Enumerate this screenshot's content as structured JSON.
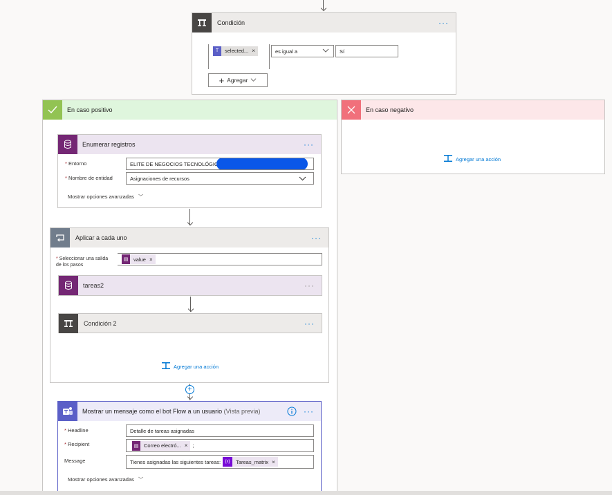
{
  "condition": {
    "title": "Condición",
    "token_label": "selected...",
    "operator": "es igual a",
    "value": "Sí",
    "add_label": "Agregar",
    "menu": "···"
  },
  "yes_branch": {
    "title": "En caso positivo"
  },
  "no_branch": {
    "title": "En caso negativo",
    "add_action": "Agregar una acción"
  },
  "list_records": {
    "title": "Enumerar registros",
    "menu": "···",
    "env_label": "Entorno",
    "env_value": "ELITE DE NEGOCIOS TECNOLÓGICOS",
    "entity_label": "Nombre de entidad",
    "entity_value": "Asignaciones de recursos",
    "advanced": "Mostrar opciones avanzadas"
  },
  "apply_each": {
    "title": "Aplicar a cada uno",
    "menu": "···",
    "select_label": "Seleccionar una salida de los pasos",
    "token_value": "value",
    "inner_1": "tareas2",
    "inner_2": "Condición 2",
    "add_action": "Agregar una acción"
  },
  "teams_msg": {
    "title": "Mostrar un mensaje como el bot Flow a un usuario",
    "preview": "(Vista previa)",
    "menu": "···",
    "headline_label": "Headline",
    "headline_value": "Detalle de tareas asignadas",
    "recipient_label": "Recipient",
    "recipient_token": "Correo electró...",
    "recipient_suffix": ";",
    "message_label": "Message",
    "message_text": "Tienes asignadas las siguientes tareas:",
    "message_token": "Tareas_matrix",
    "advanced": "Mostrar opciones avanzadas"
  },
  "colors": {
    "condition_header": "#edebe9",
    "condition_icon": "#484644",
    "yes_header": "#dff6dd",
    "yes_icon": "#92c353",
    "no_header": "#fde7e9",
    "no_icon": "#f1707b",
    "dataverse": "#742774",
    "dataverse_header": "#ece4f0",
    "loop_icon": "#717d8c",
    "teams": "#5b5fc7",
    "link": "#0078d4"
  },
  "icons": [
    "condition-icon",
    "checkmark-icon",
    "close-icon",
    "database-icon",
    "loop-icon",
    "teams-icon",
    "info-icon",
    "plus-icon",
    "chevron-down-icon",
    "add-action-icon",
    "variable-icon"
  ]
}
